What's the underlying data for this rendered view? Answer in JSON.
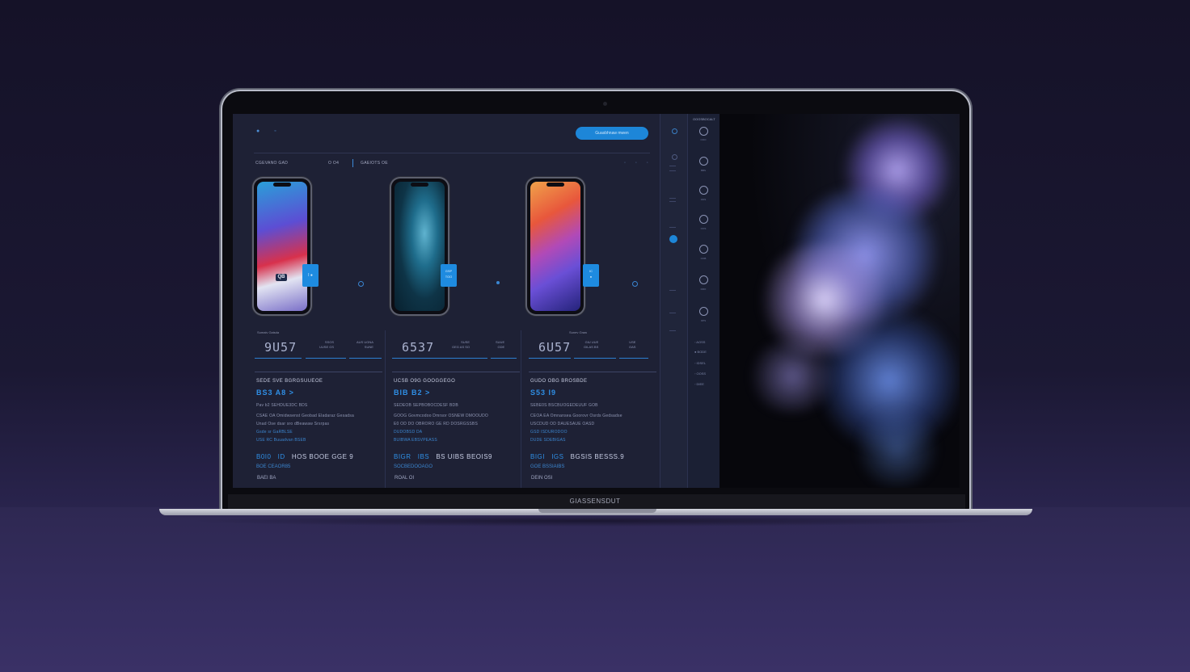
{
  "scene": {
    "brand_text": "GIASSENSDUT"
  },
  "app": {
    "cta_label": "Guasbhnaw mwen",
    "crumbs": [
      {
        "label": "CGEVANO GAD"
      },
      {
        "label": "O O4"
      },
      {
        "label": "GAEIOTS OE"
      }
    ],
    "topbar_icons": "● ◦",
    "crumb_icons": "◦ ◦ ◦"
  },
  "products": [
    {
      "screen_label": "QB",
      "badge_label": "I ●",
      "stats_title": "Sumaiv Gaisda",
      "big_number": "9U57",
      "mini_a": "SSOS\nUUSE GS",
      "mini_b": "AUS UGNA\nSUNE",
      "card_heading": "SEDE SVE BGRGSUUEOE",
      "card_price": "BS3 A8 >",
      "lines": [
        "Pav b2 SEHDUE3DC BDS",
        "CSAE OA  Omidwsenst Geobad Eladaraz Gesadsa",
        "Unad Ose dsar sro dBeawaw Srsrpas",
        "Gsde sr GaRBLSE",
        "USE RC Buuadvan BSEB"
      ],
      "row_big": [
        "B0I0",
        "ID",
        "HOS BOOE GGE 9"
      ],
      "row_sub": "BOE CEAOR85",
      "row_sub2": "BAEI BA"
    },
    {
      "screen_label": "",
      "badge_label": "GSP\nTOO",
      "stats_title": "",
      "big_number": "6537",
      "mini_a": "SUSE\nGEG AS SO",
      "mini_b": "SUUE\nGDE",
      "card_heading": "UCSB O9G GOOGGEGO",
      "card_price": "BIB B2 >",
      "lines": [
        "SEDEOB SEPBOBOCDESF BDB",
        "GOOG Govmcodoo Dmrsor OSNEW DMOOUDO",
        "E0 OD DO OBRORO GE RD DOSRGSSBS",
        "DUDOBSD DA",
        "BUIBWA EBSVPEASS"
      ],
      "row_big": [
        "BIGR",
        "IBS",
        "BS UIBS BEOIS9"
      ],
      "row_sub": "SOCBEDOOAGO",
      "row_sub2": "ROAL OI"
    },
    {
      "screen_label": "",
      "badge_label": "IC\n●",
      "stats_title": "Sunev Graw",
      "big_number": "6U57",
      "mini_a": "GIU UUE\nGILAS BS",
      "mini_b": "USE\nOAS",
      "card_heading": "GUDO OBG BROSBDE",
      "card_price": "S53 I9",
      "lines": [
        "SEBE0S BSCBUOGEDEUUF GOB",
        "CEOA EA  Omnansea Goorovr Osrds Gedsadse",
        "USCDUD OD DAUESAUE OASD",
        "GSD ISDURODOO",
        "DUDE SDEBIGAS"
      ],
      "row_big": [
        "BIGI",
        "IGS",
        "BGSIS BESSS.9"
      ],
      "row_sub": "GOE BSSIAIBS",
      "row_sub2": "DEIN OSI"
    }
  ],
  "rail": {
    "header": "OOGSBOCALT",
    "items": [
      {
        "caption": "OOO"
      },
      {
        "caption": "BBS"
      },
      {
        "caption": "ODS"
      },
      {
        "caption": "OOS"
      },
      {
        "caption": "OOB"
      },
      {
        "caption": "DRO"
      },
      {
        "caption": "OPS"
      }
    ],
    "menu": [
      "◦ AOSS",
      "● BODE",
      "◦ IDSEL",
      "◦ OOSS",
      "◦ DIEE"
    ]
  },
  "colors": {
    "accent": "#1d86d8",
    "background": "#1e2135",
    "hero_purple": "#9b8fe0"
  }
}
